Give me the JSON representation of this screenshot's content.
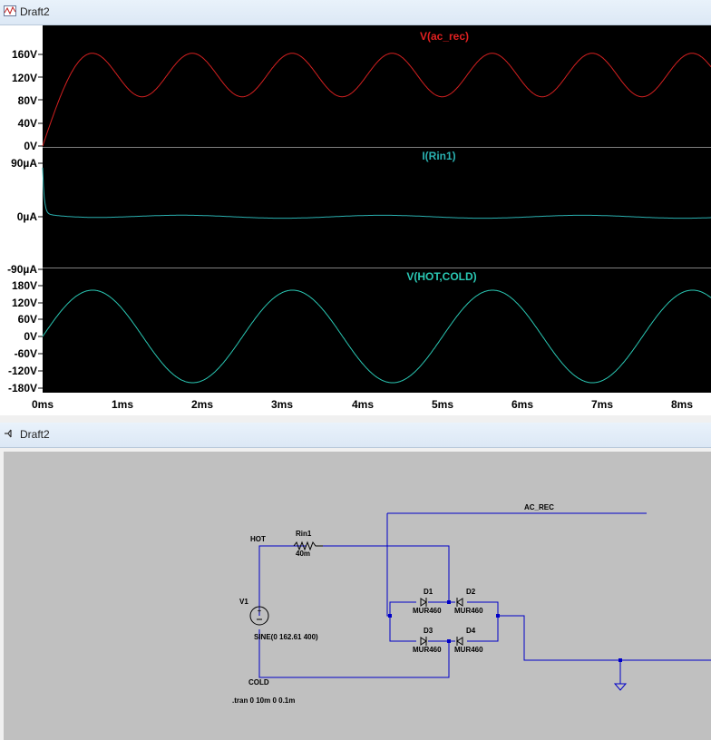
{
  "waveform_window": {
    "title": "Draft2",
    "panes": [
      {
        "trace_label": "V(ac_rec)",
        "color": "#d42020",
        "y_ticks": [
          "160V",
          "120V",
          "80V",
          "40V",
          "0V"
        ]
      },
      {
        "trace_label": "I(Rin1)",
        "color": "#2ab0b0",
        "y_ticks": [
          "90µA",
          "0µA",
          "-90µA"
        ]
      },
      {
        "trace_label": "V(HOT,COLD)",
        "color": "#2ac8b4",
        "y_ticks": [
          "180V",
          "120V",
          "60V",
          "0V",
          "-60V",
          "-120V",
          "-180V"
        ]
      }
    ],
    "x_ticks": [
      "0ms",
      "1ms",
      "2ms",
      "3ms",
      "4ms",
      "5ms",
      "6ms",
      "7ms",
      "8ms"
    ],
    "chart_data": [
      {
        "type": "line",
        "title": "V(ac_rec)",
        "ylim": [
          0,
          180
        ],
        "x_unit": "ms",
        "series": [
          {
            "name": "V(ac_rec)",
            "values": [
              [
                0,
                0
              ],
              [
                0.25,
                100
              ],
              [
                0.62,
                162
              ],
              [
                1.25,
                86
              ],
              [
                1.87,
                162
              ],
              [
                2.5,
                86
              ],
              [
                3.12,
                162
              ],
              [
                3.75,
                86
              ],
              [
                4.37,
                162
              ],
              [
                5.0,
                86
              ],
              [
                5.62,
                162
              ],
              [
                6.25,
                86
              ],
              [
                6.87,
                162
              ],
              [
                7.5,
                86
              ],
              [
                8.12,
                162
              ]
            ]
          }
        ]
      },
      {
        "type": "line",
        "title": "I(Rin1)",
        "ylim": [
          -90,
          90
        ],
        "x_unit": "ms",
        "series": [
          {
            "name": "I(Rin1)",
            "values": [
              [
                0,
                80
              ],
              [
                0.1,
                15
              ],
              [
                0.5,
                4
              ],
              [
                1.25,
                -2
              ],
              [
                2.5,
                3
              ],
              [
                3.75,
                -2
              ],
              [
                5.0,
                3
              ],
              [
                6.25,
                -2
              ],
              [
                7.5,
                3
              ],
              [
                8.2,
                -2
              ]
            ]
          }
        ]
      },
      {
        "type": "line",
        "title": "V(HOT,COLD)",
        "ylim": [
          -180,
          180
        ],
        "x_unit": "ms",
        "series": [
          {
            "name": "V(HOT,COLD)",
            "amplitude": 162.61,
            "frequency_hz": 400
          }
        ]
      }
    ]
  },
  "schematic_window": {
    "title": "Draft2",
    "labels": {
      "ac_rec": "AC_REC",
      "hot": "HOT",
      "cold": "COLD",
      "rin_name": "Rin1",
      "rin_value": "40m",
      "v1_name": "V1",
      "v1_value": "SINE(0 162.61 400)",
      "d1": "D1",
      "d2": "D2",
      "d3": "D3",
      "d4": "D4",
      "d1_model": "MUR460",
      "d2_model": "MUR460",
      "d3_model": "MUR460",
      "d4_model": "MUR460",
      "directive": ".tran 0 10m 0 0.1m"
    }
  }
}
